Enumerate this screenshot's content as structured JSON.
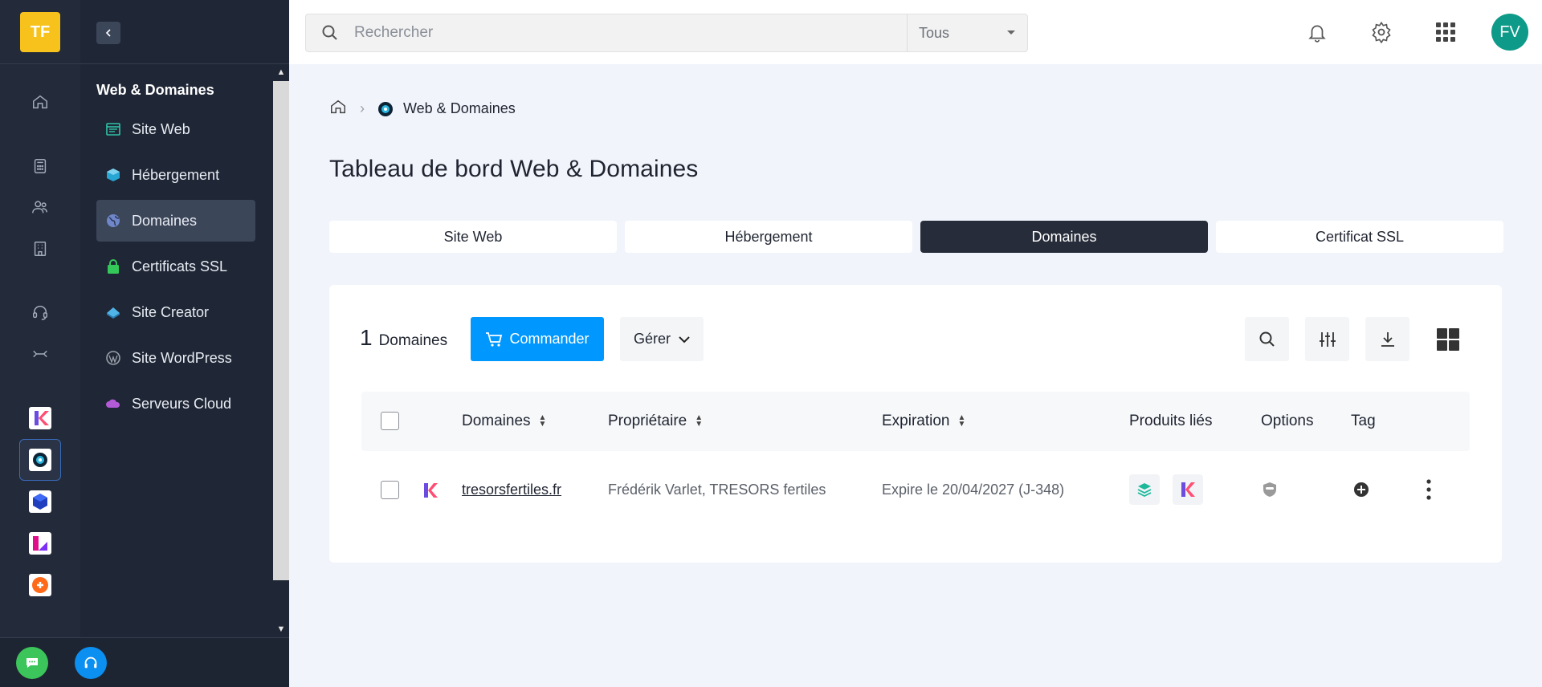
{
  "rail": {
    "logo": "TF",
    "icons": [
      "home-icon",
      "calculator-icon",
      "users-icon",
      "building-icon",
      "headset-icon",
      "settings-alt-icon"
    ],
    "apps": [
      "kdrive-app-icon",
      "web-domains-app-icon",
      "cube-app-icon",
      "kchat-app-icon",
      "swiss-backup-app-icon"
    ]
  },
  "sidebar": {
    "section_title": "Web & Domaines",
    "items": [
      {
        "label": "Site Web",
        "icon": "website-icon",
        "color": "#2fc2a7"
      },
      {
        "label": "Hébergement",
        "icon": "hosting-icon",
        "color": "#27a5d3"
      },
      {
        "label": "Domaines",
        "icon": "domain-icon",
        "color": "#6f86c9"
      },
      {
        "label": "Certificats SSL",
        "icon": "ssl-lock-icon",
        "color": "#34c759"
      },
      {
        "label": "Site Creator",
        "icon": "site-creator-icon",
        "color": "#4fb4e7"
      },
      {
        "label": "Site WordPress",
        "icon": "wordpress-icon",
        "color": "#9aa0aa"
      },
      {
        "label": "Serveurs Cloud",
        "icon": "cloud-icon",
        "color": "#b35ad6"
      }
    ]
  },
  "topbar": {
    "search_placeholder": "Rechercher",
    "search_scope": "Tous",
    "avatar": "FV"
  },
  "breadcrumb": {
    "current": "Web & Domaines"
  },
  "page": {
    "title": "Tableau de bord Web & Domaines"
  },
  "tabs": [
    {
      "label": "Site Web"
    },
    {
      "label": "Hébergement"
    },
    {
      "label": "Domaines"
    },
    {
      "label": "Certificat SSL"
    }
  ],
  "toolbar": {
    "count": "1",
    "count_label": "Domaines",
    "order_label": "Commander",
    "manage_label": "Gérer"
  },
  "table": {
    "headers": {
      "domain": "Domaines",
      "owner": "Propriétaire",
      "expiration": "Expiration",
      "products": "Produits liés",
      "options": "Options",
      "tag": "Tag"
    },
    "rows": [
      {
        "domain": "tresorsfertiles.fr",
        "owner": "Frédérik Varlet, TRESORS fertiles",
        "expiration": "Expire le  20/04/2027 (J-348)"
      }
    ]
  },
  "colors": {
    "accent": "#0098ff",
    "active_tab": "#262c39",
    "avatar": "#0d9a88",
    "logo": "#f6c21b"
  }
}
